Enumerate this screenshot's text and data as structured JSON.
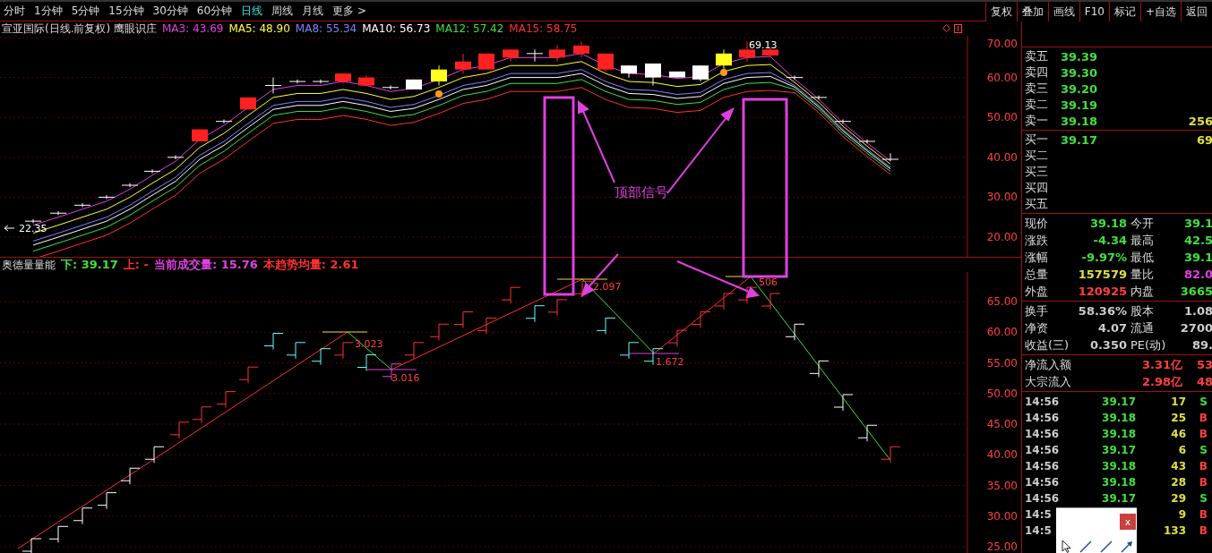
{
  "periods": [
    {
      "label": "分时",
      "selected": false
    },
    {
      "label": "1分钟",
      "selected": false
    },
    {
      "label": "5分钟",
      "selected": false
    },
    {
      "label": "15分钟",
      "selected": false
    },
    {
      "label": "30分钟",
      "selected": false
    },
    {
      "label": "60分钟",
      "selected": false
    },
    {
      "label": "日线",
      "selected": true
    },
    {
      "label": "周线",
      "selected": false
    },
    {
      "label": "月线",
      "selected": false
    },
    {
      "label": "更多 >",
      "selected": false
    }
  ],
  "toolbar_buttons": [
    "复权",
    "叠加",
    "画线",
    "F10",
    "标记",
    "+自选",
    "返回"
  ],
  "price_chart": {
    "title": "宣亚国际(日线.前复权) 鹰眼识庄",
    "indicators": [
      {
        "label": "MA3: 43.69",
        "color": "#e040e0"
      },
      {
        "label": "MA5: 48.90",
        "color": "#ffff40"
      },
      {
        "label": "MA8: 55.34",
        "color": "#8080ff"
      },
      {
        "label": "MA10: 56.73",
        "color": "#ffffff"
      },
      {
        "label": "MA12: 57.42",
        "color": "#40e040"
      },
      {
        "label": "MA15: 58.75",
        "color": "#ff3030"
      }
    ],
    "axis": [
      "70.00",
      "60.00",
      "50.00",
      "40.00",
      "30.00",
      "20.00"
    ],
    "low_label": "22.35",
    "high_label": "69.13"
  },
  "volume_chart": {
    "title": "奥德量量能",
    "indicators": [
      {
        "label": "下: 39.17",
        "color": "#40e040"
      },
      {
        "label": "上: -",
        "color": "#ff3030"
      },
      {
        "label": "当前成交量: 15.76",
        "color": "#e040e0"
      },
      {
        "label": "本趋势均量: 2.61",
        "color": "#ff3030"
      }
    ],
    "axis": [
      "65.00",
      "60.00",
      "55.00",
      "50.00",
      "45.00",
      "40.00",
      "35.00",
      "30.00",
      "25.00"
    ],
    "point_labels": [
      "3.023",
      "3.016",
      "2.097",
      "1.672",
      "506"
    ]
  },
  "annotation": "顶部信号",
  "order_book": {
    "asks": [
      {
        "label": "卖五",
        "price": "39.39"
      },
      {
        "label": "卖四",
        "price": "39.30"
      },
      {
        "label": "卖三",
        "price": "39.20"
      },
      {
        "label": "卖二",
        "price": "39.19"
      },
      {
        "label": "卖一",
        "price": "39.18",
        "volume": "256"
      }
    ],
    "bids": [
      {
        "label": "买一",
        "price": "39.17",
        "volume": "69"
      },
      {
        "label": "买二"
      },
      {
        "label": "买三"
      },
      {
        "label": "买四"
      },
      {
        "label": "买五"
      }
    ]
  },
  "quote": [
    {
      "left": {
        "label": "现价",
        "value": "39.18",
        "color": "#40e040"
      },
      "right": {
        "label": "今开",
        "value": "39.1",
        "color": "#40e040"
      }
    },
    {
      "left": {
        "label": "涨跌",
        "value": "-4.34",
        "color": "#40e040"
      },
      "right": {
        "label": "最高",
        "value": "42.5",
        "color": "#40e040"
      }
    },
    {
      "left": {
        "label": "涨幅",
        "value": "-9.97%",
        "color": "#40e040"
      },
      "right": {
        "label": "最低",
        "value": "39.1",
        "color": "#40e040"
      }
    },
    {
      "left": {
        "label": "总量",
        "value": "157579",
        "color": "#e0e040"
      },
      "right": {
        "label": "量比",
        "value": "82.0",
        "color": "#e040e0"
      }
    },
    {
      "left": {
        "label": "外盘",
        "value": "120925",
        "color": "#ff4040"
      },
      "right": {
        "label": "内盘",
        "value": "3665",
        "color": "#40e040"
      }
    }
  ],
  "stats": [
    {
      "label": "换手",
      "value": "58.36%",
      "label2": "股本",
      "value2": "1.08"
    },
    {
      "label": "净资",
      "value": "4.07",
      "label2": "流通",
      "value2": "2700"
    },
    {
      "label": "收益(三)",
      "value": "0.350",
      "label2": "PE(动)",
      "value2": "89."
    }
  ],
  "flows": [
    {
      "label": "净流入额",
      "value": "3.31亿",
      "value2": "53"
    },
    {
      "label": "大宗流入",
      "value": "2.98亿",
      "value2": "48"
    }
  ],
  "ticks": [
    {
      "time": "14:56",
      "price": "39.17",
      "volume": "17",
      "side": "S",
      "kind": "sell"
    },
    {
      "time": "14:56",
      "price": "39.18",
      "volume": "25",
      "side": "B",
      "kind": "buy"
    },
    {
      "time": "14:56",
      "price": "39.18",
      "volume": "46",
      "side": "B",
      "kind": "buy"
    },
    {
      "time": "14:56",
      "price": "39.17",
      "volume": "6",
      "side": "S",
      "kind": "sell"
    },
    {
      "time": "14:56",
      "price": "39.18",
      "volume": "43",
      "side": "B",
      "kind": "buy"
    },
    {
      "time": "14:56",
      "price": "39.18",
      "volume": "28",
      "side": "B",
      "kind": "buy"
    },
    {
      "time": "14:56",
      "price": "39.17",
      "volume": "29",
      "side": "S",
      "kind": "sell"
    },
    {
      "time": "14:5",
      "volume": "9",
      "side": "B",
      "kind": "buy"
    },
    {
      "time": "14:5",
      "volume": "133",
      "side": "B",
      "kind": "buy"
    }
  ],
  "popup": {
    "close": "x"
  }
}
